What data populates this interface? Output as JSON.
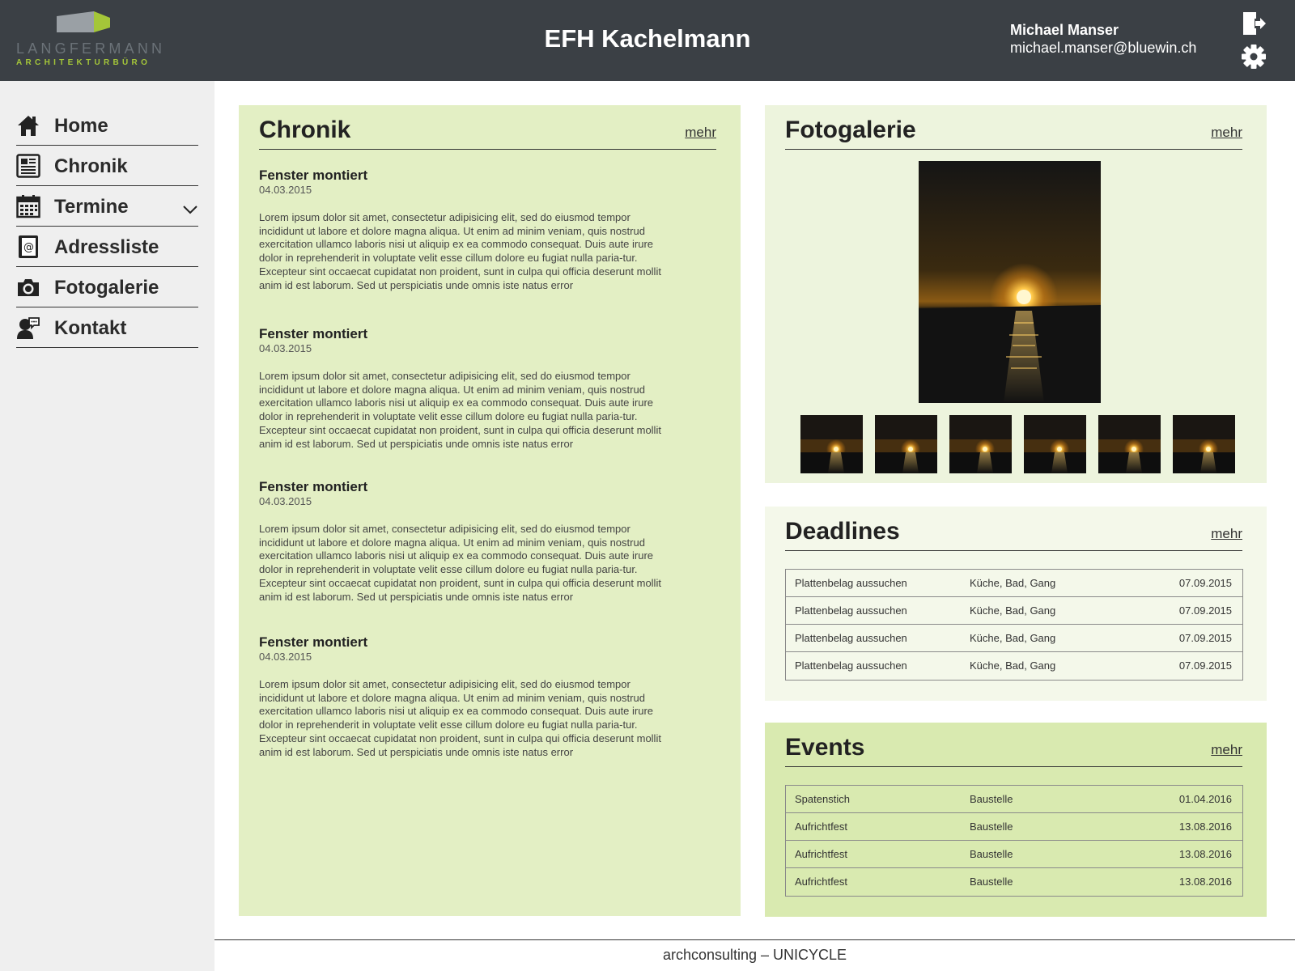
{
  "header": {
    "logo_name": "LANGFERMANN",
    "logo_sub": "ARCHITEKTURBÜRO",
    "title": "EFH Kachelmann",
    "user_name": "Michael Manser",
    "user_email": "michael.manser@bluewin.ch",
    "icons": [
      "logout-icon",
      "settings-gear-icon"
    ]
  },
  "colors": {
    "header_bg": "#3b4045",
    "accent": "#a4c639",
    "chronik_bg": "#e3efc4",
    "foto_bg": "#edf4dd",
    "deadlines_bg": "#f4f8ea",
    "events_bg": "#d9eab0",
    "sidebar_bg": "#efefef"
  },
  "sidebar": {
    "items": [
      {
        "label": "Home",
        "icon": "home-icon"
      },
      {
        "label": "Chronik",
        "icon": "newspaper-icon"
      },
      {
        "label": "Termine",
        "icon": "calendar-icon",
        "has_submenu": true
      },
      {
        "label": "Adressliste",
        "icon": "address-book-icon"
      },
      {
        "label": "Fotogalerie",
        "icon": "camera-icon"
      },
      {
        "label": "Kontakt",
        "icon": "contact-person-icon"
      }
    ]
  },
  "chronik": {
    "title": "Chronik",
    "more": "mehr",
    "entries": [
      {
        "title": "Fenster montiert",
        "date": "04.03.2015",
        "text": "Lorem ipsum dolor sit amet, consectetur adipisicing elit, sed do eiusmod tempor incididunt ut labore et dolore magna aliqua. Ut enim ad minim veniam, quis nostrud exercitation ullamco laboris nisi ut aliquip ex ea commodo consequat. Duis aute irure dolor in reprehenderit in voluptate velit esse cillum dolore eu fugiat nulla paria-tur. Excepteur sint occaecat cupidatat non proident, sunt in culpa qui officia deserunt mollit anim id est laborum. Sed ut perspiciatis unde omnis iste natus error"
      },
      {
        "title": "Fenster montiert",
        "date": "04.03.2015",
        "text": "Lorem ipsum dolor sit amet, consectetur adipisicing elit, sed do eiusmod tempor incididunt ut labore et dolore magna aliqua. Ut enim ad minim veniam, quis nostrud exercitation ullamco laboris nisi ut aliquip ex ea commodo consequat. Duis aute irure dolor in reprehenderit in voluptate velit esse cillum dolore eu fugiat nulla paria-tur. Excepteur sint occaecat cupidatat non proident, sunt in culpa qui officia deserunt mollit anim id est laborum. Sed ut perspiciatis unde omnis iste natus error"
      },
      {
        "title": "Fenster montiert",
        "date": "04.03.2015",
        "text": "Lorem ipsum dolor sit amet, consectetur adipisicing elit, sed do eiusmod tempor incididunt ut labore et dolore magna aliqua. Ut enim ad minim veniam, quis nostrud exercitation ullamco laboris nisi ut aliquip ex ea commodo consequat. Duis aute irure dolor in reprehenderit in voluptate velit esse cillum dolore eu fugiat nulla paria-tur. Excepteur sint occaecat cupidatat non proident, sunt in culpa qui officia deserunt mollit anim id est laborum. Sed ut perspiciatis unde omnis iste natus error"
      },
      {
        "title": "Fenster montiert",
        "date": "04.03.2015",
        "text": "Lorem ipsum dolor sit amet, consectetur adipisicing elit, sed do eiusmod tempor incididunt ut labore et dolore magna aliqua. Ut enim ad minim veniam, quis nostrud exercitation ullamco laboris nisi ut aliquip ex ea commodo consequat. Duis aute irure dolor in reprehenderit in voluptate velit esse cillum dolore eu fugiat nulla paria-tur. Excepteur sint occaecat cupidatat non proident, sunt in culpa qui officia deserunt mollit anim id est laborum. Sed ut perspiciatis unde omnis iste natus error"
      }
    ]
  },
  "fotogalerie": {
    "title": "Fotogalerie",
    "more": "mehr",
    "thumbnail_count": 6
  },
  "deadlines": {
    "title": "Deadlines",
    "more": "mehr",
    "rows": [
      [
        "Plattenbelag aussuchen",
        "Küche, Bad, Gang",
        "07.09.2015"
      ],
      [
        "Plattenbelag aussuchen",
        "Küche, Bad, Gang",
        "07.09.2015"
      ],
      [
        "Plattenbelag aussuchen",
        "Küche, Bad, Gang",
        "07.09.2015"
      ],
      [
        "Plattenbelag aussuchen",
        "Küche, Bad, Gang",
        "07.09.2015"
      ]
    ]
  },
  "events": {
    "title": "Events",
    "more": "mehr",
    "rows": [
      [
        "Spatenstich",
        "Baustelle",
        "01.04.2016"
      ],
      [
        "Aufrichtfest",
        "Baustelle",
        "13.08.2016"
      ],
      [
        "Aufrichtfest",
        "Baustelle",
        "13.08.2016"
      ],
      [
        "Aufrichtfest",
        "Baustelle",
        "13.08.2016"
      ]
    ]
  },
  "footer": {
    "text": "archconsulting – UNICYCLE"
  }
}
